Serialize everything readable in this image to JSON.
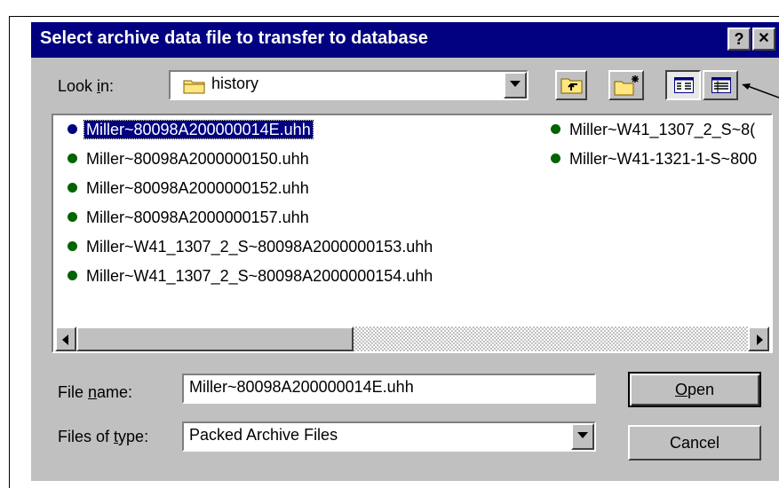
{
  "window": {
    "title": "Select archive data file to transfer to database",
    "help_button": "?",
    "close_button": "✕"
  },
  "look_in": {
    "label": "Look in:",
    "value": "history",
    "folder_icon": "folder-icon"
  },
  "toolbar": {
    "icons": [
      "up-one-level-icon",
      "create-new-folder-icon",
      "list-view-icon",
      "details-view-icon"
    ]
  },
  "files": [
    {
      "name": "Miller~80098A200000014E.uhh",
      "selected": true
    },
    {
      "name": "Miller~80098A2000000150.uhh"
    },
    {
      "name": "Miller~80098A2000000152.uhh"
    },
    {
      "name": "Miller~80098A2000000157.uhh"
    },
    {
      "name": "Miller~W41_1307_2_S~80098A2000000153.uhh"
    },
    {
      "name": "Miller~W41_1307_2_S~80098A2000000154.uhh"
    },
    {
      "name": "Miller~W41_1307_2_S~8("
    },
    {
      "name": "Miller~W41-1321-1-S~800"
    }
  ],
  "file_name": {
    "label": "File name:",
    "value": "Miller~80098A200000014E.uhh"
  },
  "file_type": {
    "label": "Files of type:",
    "value": "Packed Archive Files"
  },
  "buttons": {
    "open": "Open",
    "cancel": "Cancel"
  },
  "colors": {
    "title_bar": "#000080",
    "dialog_face": "#c0c0c0",
    "file_bullet": "#006400"
  }
}
